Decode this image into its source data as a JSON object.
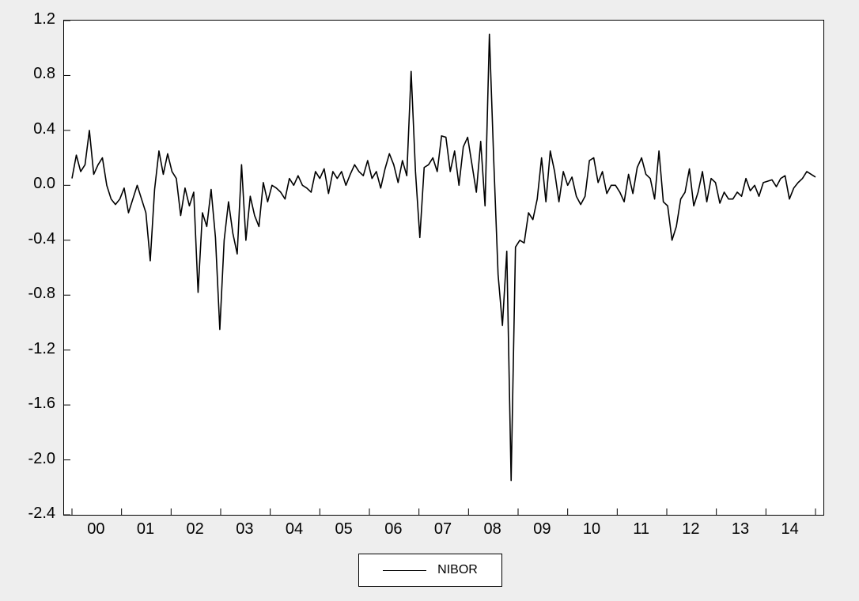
{
  "chart_data": {
    "type": "line",
    "series": [
      {
        "name": "NIBOR",
        "values": [
          0.05,
          0.22,
          0.1,
          0.15,
          0.4,
          0.08,
          0.15,
          0.2,
          0.0,
          -0.1,
          -0.14,
          -0.1,
          -0.02,
          -0.2,
          -0.1,
          0.0,
          -0.1,
          -0.2,
          -0.55,
          -0.03,
          0.25,
          0.08,
          0.23,
          0.1,
          0.05,
          -0.22,
          -0.02,
          -0.15,
          -0.05,
          -0.78,
          -0.2,
          -0.3,
          -0.03,
          -0.38,
          -1.05,
          -0.4,
          -0.12,
          -0.35,
          -0.5,
          0.15,
          -0.4,
          -0.08,
          -0.22,
          -0.3,
          0.02,
          -0.12,
          0.0,
          -0.02,
          -0.05,
          -0.1,
          0.05,
          0.0,
          0.07,
          0.0,
          -0.02,
          -0.05,
          0.1,
          0.05,
          0.12,
          -0.06,
          0.1,
          0.05,
          0.1,
          0.0,
          0.08,
          0.15,
          0.1,
          0.07,
          0.18,
          0.05,
          0.1,
          -0.02,
          0.12,
          0.23,
          0.15,
          0.02,
          0.18,
          0.07,
          0.83,
          0.1,
          -0.38,
          0.13,
          0.15,
          0.2,
          0.1,
          0.36,
          0.35,
          0.1,
          0.25,
          0.0,
          0.28,
          0.35,
          0.15,
          -0.05,
          0.32,
          -0.15,
          1.1,
          0.18,
          -0.65,
          -1.02,
          -0.48,
          -2.15,
          -0.45,
          -0.4,
          -0.42,
          -0.2,
          -0.25,
          -0.1,
          0.2,
          -0.12,
          0.25,
          0.1,
          -0.12,
          0.1,
          0.0,
          0.06,
          -0.08,
          -0.14,
          -0.08,
          0.18,
          0.2,
          0.02,
          0.1,
          -0.06,
          0.0,
          0.0,
          -0.05,
          -0.12,
          0.08,
          -0.06,
          0.13,
          0.2,
          0.08,
          0.05,
          -0.1,
          0.25,
          -0.12,
          -0.15,
          -0.4,
          -0.3,
          -0.1,
          -0.05,
          0.12,
          -0.15,
          -0.05,
          0.1,
          -0.12,
          0.05,
          0.02,
          -0.13,
          -0.05,
          -0.1,
          -0.1,
          -0.05,
          -0.08,
          0.05,
          -0.04,
          0.0,
          -0.08,
          0.02,
          0.03,
          0.04,
          -0.01,
          0.05,
          0.07,
          -0.1,
          -0.02,
          0.02,
          0.05,
          0.1,
          0.08,
          0.06
        ]
      }
    ],
    "x_start_year": 2000,
    "x_end_year": 2014,
    "points_per_year": 12,
    "x_ticks": [
      "00",
      "01",
      "02",
      "03",
      "04",
      "05",
      "06",
      "07",
      "08",
      "09",
      "10",
      "11",
      "12",
      "13",
      "14"
    ],
    "y_ticks": [
      -2.4,
      -2.0,
      -1.6,
      -1.2,
      -0.8,
      -0.4,
      0.0,
      0.4,
      0.8,
      1.2
    ],
    "ylim": [
      -2.4,
      1.2
    ],
    "title": "",
    "xlabel": "",
    "ylabel": "",
    "legend": {
      "position": "bottom",
      "items": [
        "NIBOR"
      ]
    },
    "grid": false,
    "line_color": "#000000"
  },
  "legend_label": "NIBOR"
}
